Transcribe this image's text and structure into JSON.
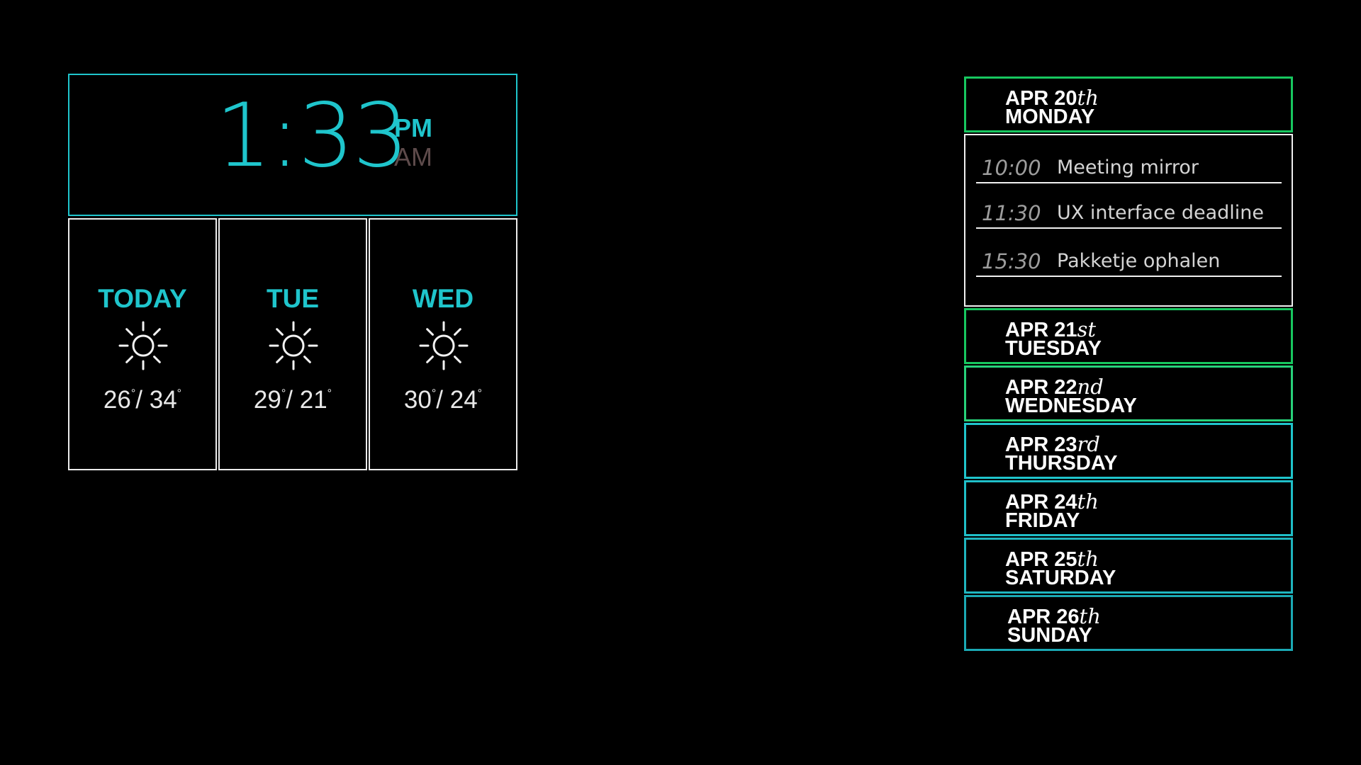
{
  "clock": {
    "time": "1:33",
    "pm_label": "PM",
    "am_label": "AM",
    "active_period": "PM",
    "colors": {
      "accent": "#1fc5cc",
      "inactive": "#5e4b4b"
    }
  },
  "weather": [
    {
      "day": "TODAY",
      "icon": "sun-icon",
      "low": "26",
      "high": "34",
      "separator": "/",
      "degree": "°"
    },
    {
      "day": "TUE",
      "icon": "sun-icon",
      "low": "29",
      "high": "21",
      "separator": "/",
      "degree": "°"
    },
    {
      "day": "WED",
      "icon": "sun-icon",
      "low": "30",
      "high": "24",
      "separator": "/",
      "degree": "°"
    }
  ],
  "calendar": {
    "days": [
      {
        "date": "APR 20",
        "suffix": "th",
        "weekday": "MONDAY",
        "border_color": "#17c75f"
      },
      {
        "date": "APR 21",
        "suffix": "st",
        "weekday": "TUESDAY",
        "border_color": "#17c75f"
      },
      {
        "date": "APR 22",
        "suffix": "nd",
        "weekday": "WEDNESDAY",
        "border_color": "#27d27a"
      },
      {
        "date": "APR 23",
        "suffix": "rd",
        "weekday": "THURSDAY",
        "border_color": "#1fc5cc"
      },
      {
        "date": "APR 24",
        "suffix": "th",
        "weekday": "FRIDAY",
        "border_color": "#1fbfc8"
      },
      {
        "date": "APR 25",
        "suffix": "th",
        "weekday": "SATURDAY",
        "border_color": "#1fb5bf"
      },
      {
        "date": "APR 26",
        "suffix": "th",
        "weekday": "SUNDAY",
        "border_color": "#1ba9b4"
      }
    ],
    "events": [
      {
        "time": "10:00",
        "title": "Meeting mirror"
      },
      {
        "time": "11:30",
        "title": "UX interface deadline"
      },
      {
        "time": "15:30",
        "title": "Pakketje ophalen"
      }
    ]
  }
}
